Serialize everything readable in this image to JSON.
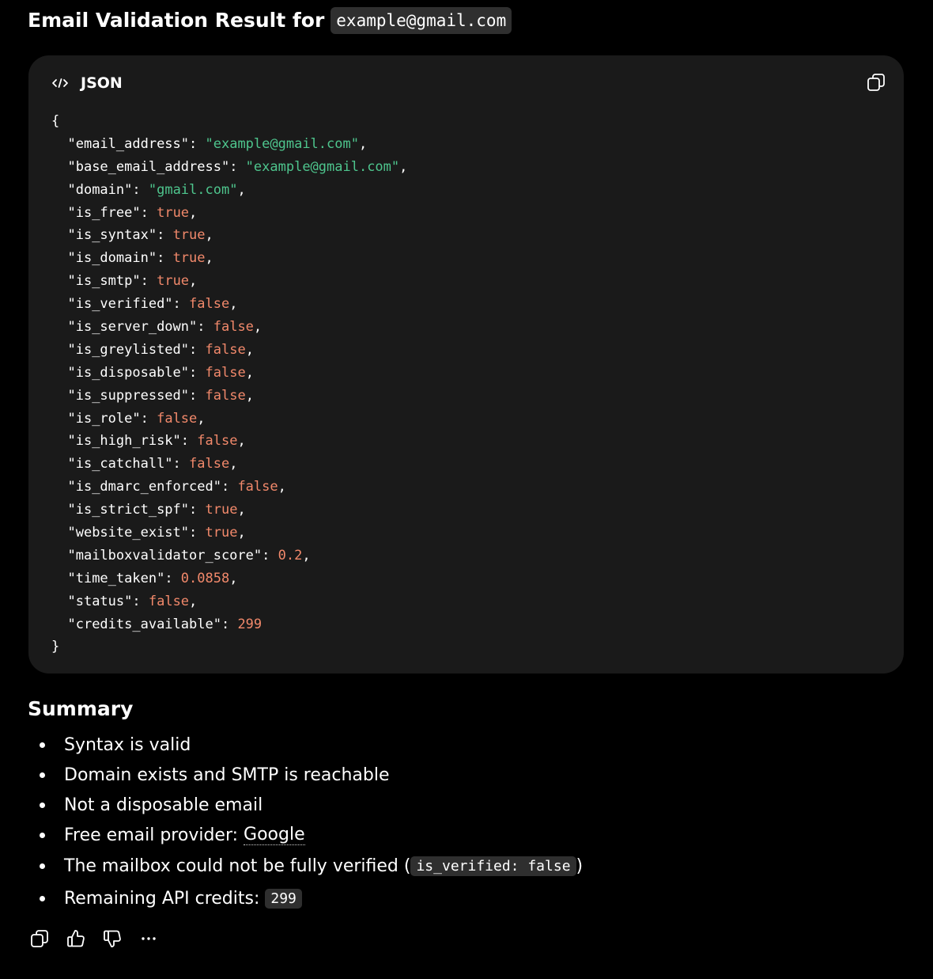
{
  "heading": {
    "text": "Email Validation Result for",
    "email": "example@gmail.com"
  },
  "code_block": {
    "language": "JSON",
    "open_brace": "{",
    "close_brace": "}",
    "lines": [
      {
        "key": "\"email_address\"",
        "value": "\"example@gmail.com\"",
        "type": "str",
        "comma": ","
      },
      {
        "key": "\"base_email_address\"",
        "value": "\"example@gmail.com\"",
        "type": "str",
        "comma": ","
      },
      {
        "key": "\"domain\"",
        "value": "\"gmail.com\"",
        "type": "str",
        "comma": ","
      },
      {
        "key": "\"is_free\"",
        "value": "true",
        "type": "bool",
        "comma": ","
      },
      {
        "key": "\"is_syntax\"",
        "value": "true",
        "type": "bool",
        "comma": ","
      },
      {
        "key": "\"is_domain\"",
        "value": "true",
        "type": "bool",
        "comma": ","
      },
      {
        "key": "\"is_smtp\"",
        "value": "true",
        "type": "bool",
        "comma": ","
      },
      {
        "key": "\"is_verified\"",
        "value": "false",
        "type": "bool",
        "comma": ","
      },
      {
        "key": "\"is_server_down\"",
        "value": "false",
        "type": "bool",
        "comma": ","
      },
      {
        "key": "\"is_greylisted\"",
        "value": "false",
        "type": "bool",
        "comma": ","
      },
      {
        "key": "\"is_disposable\"",
        "value": "false",
        "type": "bool",
        "comma": ","
      },
      {
        "key": "\"is_suppressed\"",
        "value": "false",
        "type": "bool",
        "comma": ","
      },
      {
        "key": "\"is_role\"",
        "value": "false",
        "type": "bool",
        "comma": ","
      },
      {
        "key": "\"is_high_risk\"",
        "value": "false",
        "type": "bool",
        "comma": ","
      },
      {
        "key": "\"is_catchall\"",
        "value": "false",
        "type": "bool",
        "comma": ","
      },
      {
        "key": "\"is_dmarc_enforced\"",
        "value": "false",
        "type": "bool",
        "comma": ","
      },
      {
        "key": "\"is_strict_spf\"",
        "value": "true",
        "type": "bool",
        "comma": ","
      },
      {
        "key": "\"website_exist\"",
        "value": "true",
        "type": "bool",
        "comma": ","
      },
      {
        "key": "\"mailboxvalidator_score\"",
        "value": "0.2",
        "type": "num",
        "comma": ","
      },
      {
        "key": "\"time_taken\"",
        "value": "0.0858",
        "type": "num",
        "comma": ","
      },
      {
        "key": "\"status\"",
        "value": "false",
        "type": "bool",
        "comma": ","
      },
      {
        "key": "\"credits_available\"",
        "value": "299",
        "type": "num",
        "comma": ""
      }
    ],
    "icons": {
      "language": "code-icon",
      "copy": "copy-icon"
    },
    "colors": {
      "string": "#4ec58d",
      "literal": "#f2896b",
      "background": "#1a1a1a"
    }
  },
  "summary": {
    "title": "Summary",
    "item1": "Syntax is valid",
    "item2": "Domain exists and SMTP is reachable",
    "item3": "Not a disposable email",
    "item4_prefix": "Free email provider: ",
    "item4_link": "Google",
    "item5_prefix": "The mailbox could not be fully verified (",
    "item5_code": "is_verified: false",
    "item5_suffix": ")",
    "item6_prefix": "Remaining API credits: ",
    "item6_code": "299"
  },
  "actions": {
    "icons": [
      "copy-icon",
      "thumbs-up-icon",
      "thumbs-down-icon",
      "more-icon"
    ]
  }
}
